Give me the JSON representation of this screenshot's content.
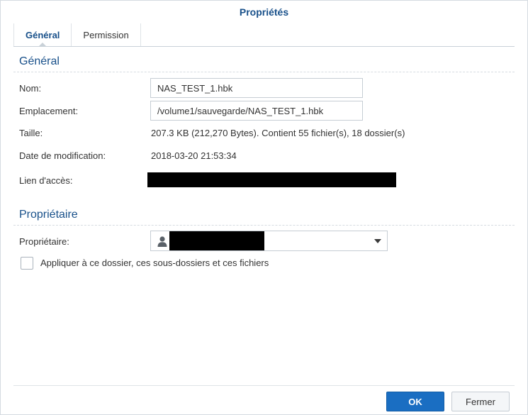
{
  "dialog": {
    "title": "Propriétés"
  },
  "tabs": [
    {
      "label": "Général",
      "active": true
    },
    {
      "label": "Permission",
      "active": false
    }
  ],
  "general": {
    "section_title": "Général",
    "name_label": "Nom:",
    "name_value": "NAS_TEST_1.hbk",
    "location_label": "Emplacement:",
    "location_value": "/volume1/sauvegarde/NAS_TEST_1.hbk",
    "size_label": "Taille:",
    "size_value": "207.3 KB (212,270 Bytes). Contient 55 fichier(s), 18 dossier(s)",
    "modified_label": "Date de modification:",
    "modified_value": "2018-03-20 21:53:34",
    "access_link_label": "Lien d'accès:"
  },
  "owner": {
    "section_title": "Propriétaire",
    "owner_label": "Propriétaire:",
    "apply_recursive_label": "Appliquer à ce dossier, ces sous-dossiers et ces fichiers",
    "apply_recursive_checked": false
  },
  "footer": {
    "ok_label": "OK",
    "close_label": "Fermer"
  },
  "colors": {
    "accent": "#18508a",
    "primary_button": "#1a6ec2",
    "redaction": "#000000"
  }
}
